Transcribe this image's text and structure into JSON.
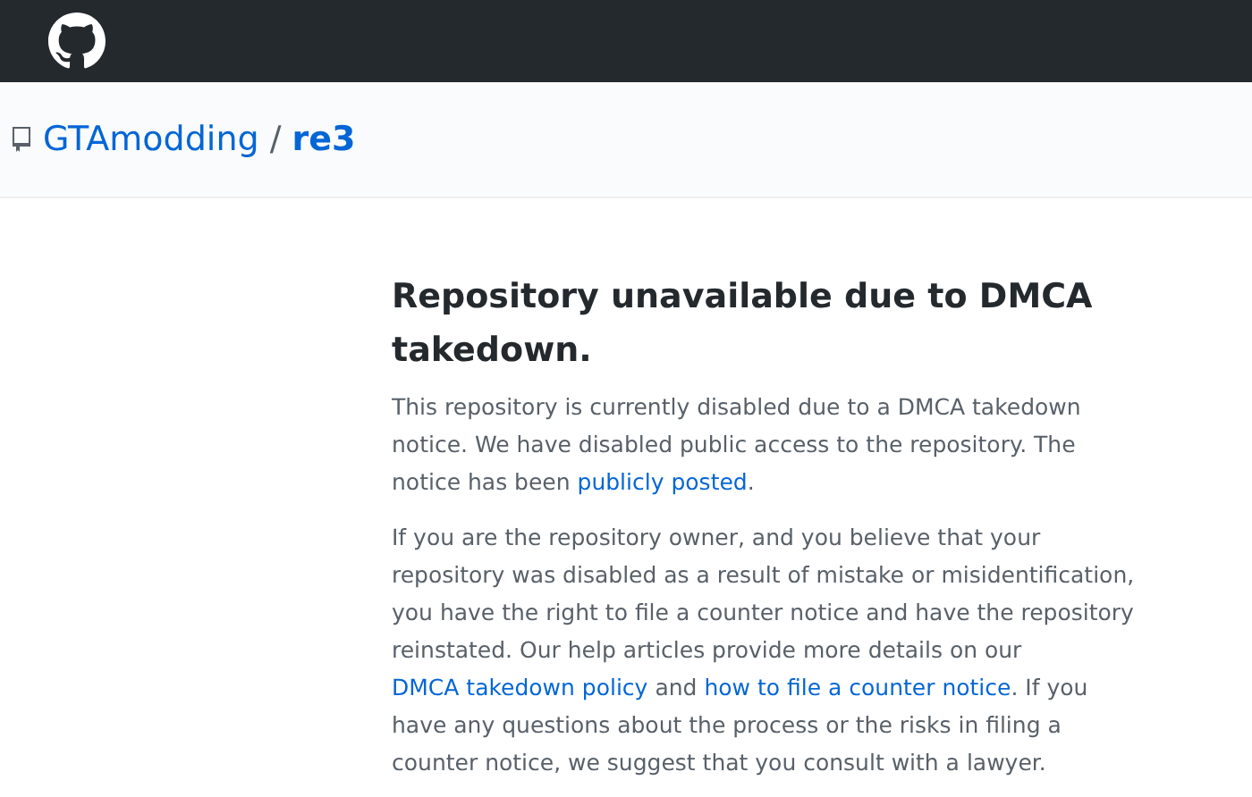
{
  "repo": {
    "owner": "GTAmodding",
    "separator": "/",
    "name": "re3"
  },
  "notice": {
    "title": "Repository unavailable due to DMCA takedown.",
    "paragraphs": [
      [
        {
          "kind": "text",
          "text": "This repository is currently disabled due to a DMCA takedown notice. We have disabled public access to the repository. The notice has been "
        },
        {
          "kind": "link",
          "text": "publicly posted"
        },
        {
          "kind": "text",
          "text": "."
        }
      ],
      [
        {
          "kind": "text",
          "text": "If you are the repository owner, and you believe that your repository was disabled as a result of mistake or misidentification, you have the right to file a counter notice and have the repository reinstated. Our help articles provide more details on our "
        },
        {
          "kind": "link",
          "text": "DMCA takedown policy"
        },
        {
          "kind": "text",
          "text": " and "
        },
        {
          "kind": "link",
          "text": "how to file a counter notice"
        },
        {
          "kind": "text",
          "text": ". If you have any questions about the process or the risks in filing a counter notice, we suggest that you consult with a lawyer."
        }
      ]
    ]
  }
}
